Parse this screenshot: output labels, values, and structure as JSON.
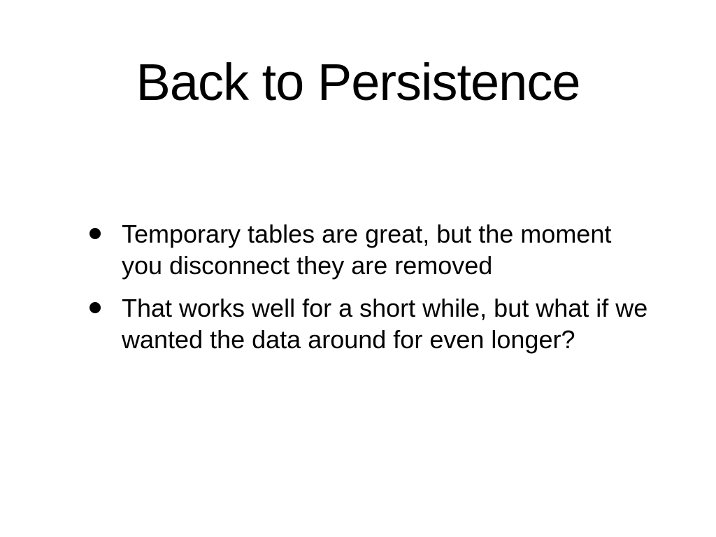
{
  "slide": {
    "title": "Back to Persistence",
    "bullets": [
      "Temporary tables are great, but the moment you disconnect they are removed",
      "That works well for a short while, but what if we wanted the data around for even longer?"
    ]
  }
}
